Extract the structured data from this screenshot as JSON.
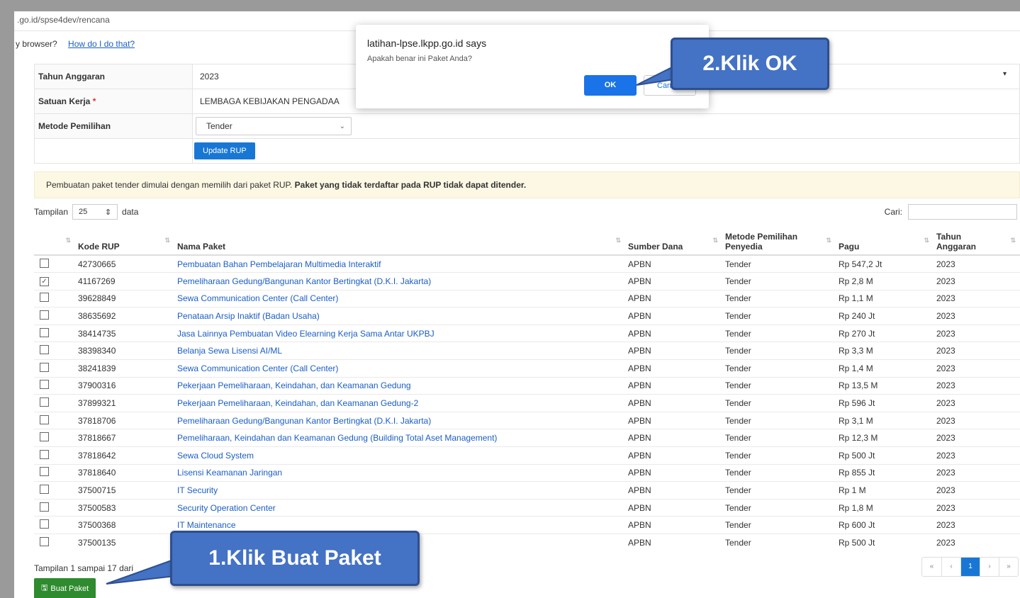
{
  "browser": {
    "url": ".go.id/spse4dev/rencana",
    "question": "y browser?",
    "help_link": "How do I do that?"
  },
  "form": {
    "tahun_label": "Tahun Anggaran",
    "tahun_value": "2023",
    "satuan_label": "Satuan Kerja",
    "satuan_required": "*",
    "satuan_value": "LEMBAGA KEBIJAKAN PENGADAA",
    "metode_label": "Metode Pemilihan",
    "metode_value": "Tender",
    "update_button": "Update RUP"
  },
  "alert": {
    "text": "Pembuatan paket tender dimulai dengan memilih dari paket RUP.",
    "bold_text": "Paket yang tidak terdaftar pada RUP tidak dapat ditender."
  },
  "table_controls": {
    "show_label": "Tampilan",
    "show_value": "25",
    "data_label": "data",
    "search_label": "Cari:"
  },
  "table": {
    "headers": {
      "kode": "Kode RUP",
      "nama": "Nama Paket",
      "sumber": "Sumber Dana",
      "metode_1": "Metode Pemilihan",
      "metode_2": "Penyedia",
      "pagu": "Pagu",
      "tahun_1": "Tahun",
      "tahun_2": "Anggaran"
    },
    "rows": [
      {
        "checked": false,
        "kode": "42730665",
        "nama": "Pembuatan Bahan Pembelajaran Multimedia Interaktif",
        "sumber": "APBN",
        "metode": "Tender",
        "pagu": "Rp 547,2 Jt",
        "tahun": "2023"
      },
      {
        "checked": true,
        "kode": "41167269",
        "nama": "Pemeliharaan Gedung/Bangunan Kantor Bertingkat (D.K.I. Jakarta)",
        "sumber": "APBN",
        "metode": "Tender",
        "pagu": "Rp 2,8 M",
        "tahun": "2023"
      },
      {
        "checked": false,
        "kode": "39628849",
        "nama": "Sewa Communication Center (Call Center)",
        "sumber": "APBN",
        "metode": "Tender",
        "pagu": "Rp 1,1 M",
        "tahun": "2023"
      },
      {
        "checked": false,
        "kode": "38635692",
        "nama": "Penataan Arsip Inaktif (Badan Usaha)",
        "sumber": "APBN",
        "metode": "Tender",
        "pagu": "Rp 240 Jt",
        "tahun": "2023"
      },
      {
        "checked": false,
        "kode": "38414735",
        "nama": "Jasa Lainnya Pembuatan Video Elearning Kerja Sama Antar UKPBJ",
        "sumber": "APBN",
        "metode": "Tender",
        "pagu": "Rp 270 Jt",
        "tahun": "2023"
      },
      {
        "checked": false,
        "kode": "38398340",
        "nama": "Belanja Sewa Lisensi AI/ML",
        "sumber": "APBN",
        "metode": "Tender",
        "pagu": "Rp 3,3 M",
        "tahun": "2023"
      },
      {
        "checked": false,
        "kode": "38241839",
        "nama": "Sewa Communication Center (Call Center)",
        "sumber": "APBN",
        "metode": "Tender",
        "pagu": "Rp 1,4 M",
        "tahun": "2023"
      },
      {
        "checked": false,
        "kode": "37900316",
        "nama": "Pekerjaan Pemeliharaan, Keindahan, dan Keamanan Gedung",
        "sumber": "APBN",
        "metode": "Tender",
        "pagu": "Rp 13,5 M",
        "tahun": "2023"
      },
      {
        "checked": false,
        "kode": "37899321",
        "nama": "Pekerjaan Pemeliharaan, Keindahan, dan Keamanan Gedung-2",
        "sumber": "APBN",
        "metode": "Tender",
        "pagu": "Rp 596 Jt",
        "tahun": "2023"
      },
      {
        "checked": false,
        "kode": "37818706",
        "nama": "Pemeliharaan Gedung/Bangunan Kantor Bertingkat (D.K.I. Jakarta)",
        "sumber": "APBN",
        "metode": "Tender",
        "pagu": "Rp 3,1 M",
        "tahun": "2023"
      },
      {
        "checked": false,
        "kode": "37818667",
        "nama": "Pemeliharaan, Keindahan dan Keamanan Gedung (Building Total Aset Management)",
        "sumber": "APBN",
        "metode": "Tender",
        "pagu": "Rp 12,3 M",
        "tahun": "2023"
      },
      {
        "checked": false,
        "kode": "37818642",
        "nama": "Sewa Cloud System",
        "sumber": "APBN",
        "metode": "Tender",
        "pagu": "Rp 500 Jt",
        "tahun": "2023"
      },
      {
        "checked": false,
        "kode": "37818640",
        "nama": "Lisensi Keamanan Jaringan",
        "sumber": "APBN",
        "metode": "Tender",
        "pagu": "Rp 855 Jt",
        "tahun": "2023"
      },
      {
        "checked": false,
        "kode": "37500715",
        "nama": "IT Security",
        "sumber": "APBN",
        "metode": "Tender",
        "pagu": "Rp 1 M",
        "tahun": "2023"
      },
      {
        "checked": false,
        "kode": "37500583",
        "nama": "Security Operation Center",
        "sumber": "APBN",
        "metode": "Tender",
        "pagu": "Rp 1,8 M",
        "tahun": "2023"
      },
      {
        "checked": false,
        "kode": "37500368",
        "nama": "IT Maintenance",
        "sumber": "APBN",
        "metode": "Tender",
        "pagu": "Rp 600 Jt",
        "tahun": "2023"
      },
      {
        "checked": false,
        "kode": "37500135",
        "nama": "",
        "sumber": "APBN",
        "metode": "Tender",
        "pagu": "Rp 500 Jt",
        "tahun": "2023"
      }
    ]
  },
  "footer": {
    "info": "Tampilan 1 sampai 17 dari",
    "buat_button": "Buat Paket",
    "pager": [
      "«",
      "‹",
      "1",
      "›",
      "»"
    ]
  },
  "dialog": {
    "title": "latihan-lpse.lkpp.go.id says",
    "message": "Apakah benar ini Paket Anda?",
    "ok": "OK",
    "cancel": "Can"
  },
  "callouts": {
    "ok": "2.Klik OK",
    "buat": "1.Klik Buat Paket"
  },
  "colors": {
    "primary": "#1877d5",
    "success": "#2e8b2e",
    "callout": "#4472c4",
    "link": "#1a5ec4"
  }
}
